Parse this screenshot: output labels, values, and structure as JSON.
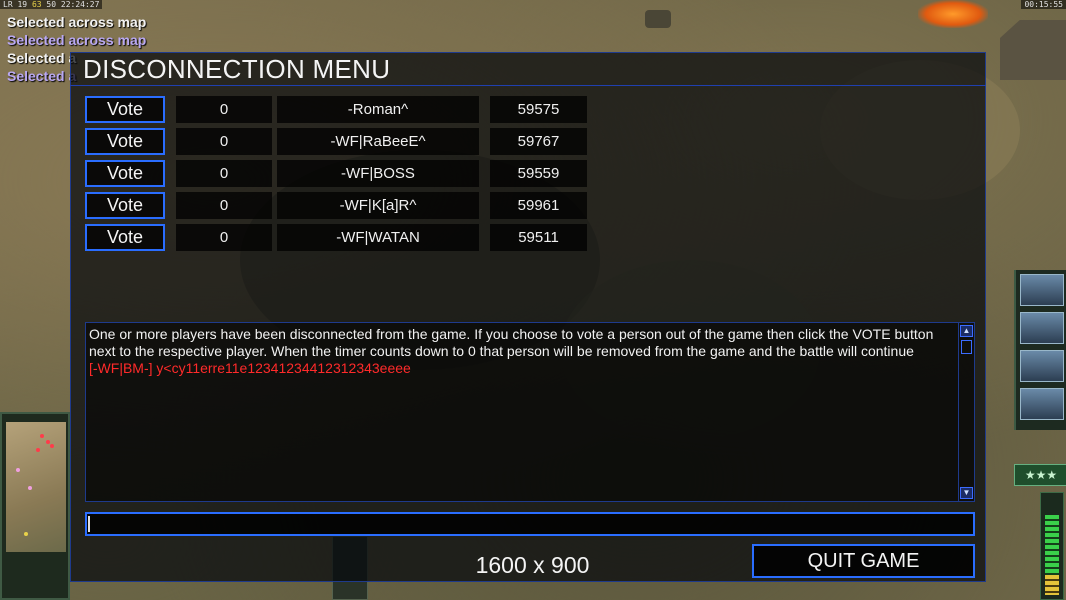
{
  "hud": {
    "top_left_a": "LR",
    "top_left_b": "19",
    "top_left_c": "63",
    "top_left_d": "50",
    "top_left_time": "22:24:27",
    "top_right_time": "00:15:55"
  },
  "messages": [
    "Selected across map",
    "Selected across map",
    "Selected a",
    "Selected a"
  ],
  "dialog": {
    "title": "DISCONNECTION MENU",
    "vote_label": "Vote",
    "players": [
      {
        "votes": "0",
        "name": "-Roman^",
        "ping": "59575"
      },
      {
        "votes": "0",
        "name": "-WF|RaBeeE^",
        "ping": "59767"
      },
      {
        "votes": "0",
        "name": "-WF|BOSS",
        "ping": "59559"
      },
      {
        "votes": "0",
        "name": "-WF|K[a]R^",
        "ping": "59961"
      },
      {
        "votes": "0",
        "name": "-WF|WATAN",
        "ping": "59511"
      }
    ],
    "info_text": "One or more players have been disconnected from the game. If you choose to vote a person out of the game then click the VOTE button next to the respective player. When the timer counts down to 0 that person will be removed from the game and the battle will continue",
    "chat_line": "[-WF|BM-] y<cy11erre11e12341234412312343eeee",
    "chat_input_value": "",
    "resolution": "1600 x 900",
    "quit_label": "QUIT GAME"
  },
  "side": {
    "rank_stars": "★★★",
    "power_level": 0.82
  },
  "colors": {
    "accent_blue": "#2a6dff",
    "chat_red": "#ff2a2a",
    "message_purple": "#b9a8f2"
  }
}
